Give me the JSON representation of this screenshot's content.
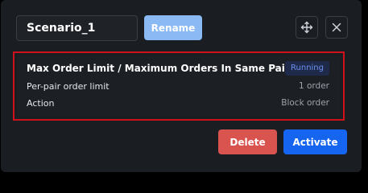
{
  "scenario": {
    "name_value": "Scenario_1",
    "rename_label": "Rename"
  },
  "header_icons": {
    "move": "move-arrows-icon",
    "close": "close-icon"
  },
  "rule": {
    "title": "Max Order Limit / Maximum Orders In Same Pair",
    "status": "Running",
    "rows": [
      {
        "label": "Per-pair order limit",
        "value": "1 order"
      },
      {
        "label": "Action",
        "value": "Block order"
      }
    ]
  },
  "footer": {
    "delete_label": "Delete",
    "activate_label": "Activate"
  },
  "colors": {
    "highlight_border": "#d0111c",
    "rename": "#8ab9f4",
    "delete": "#d9534f",
    "activate": "#1565f0",
    "status_text": "#6c8ff0"
  }
}
